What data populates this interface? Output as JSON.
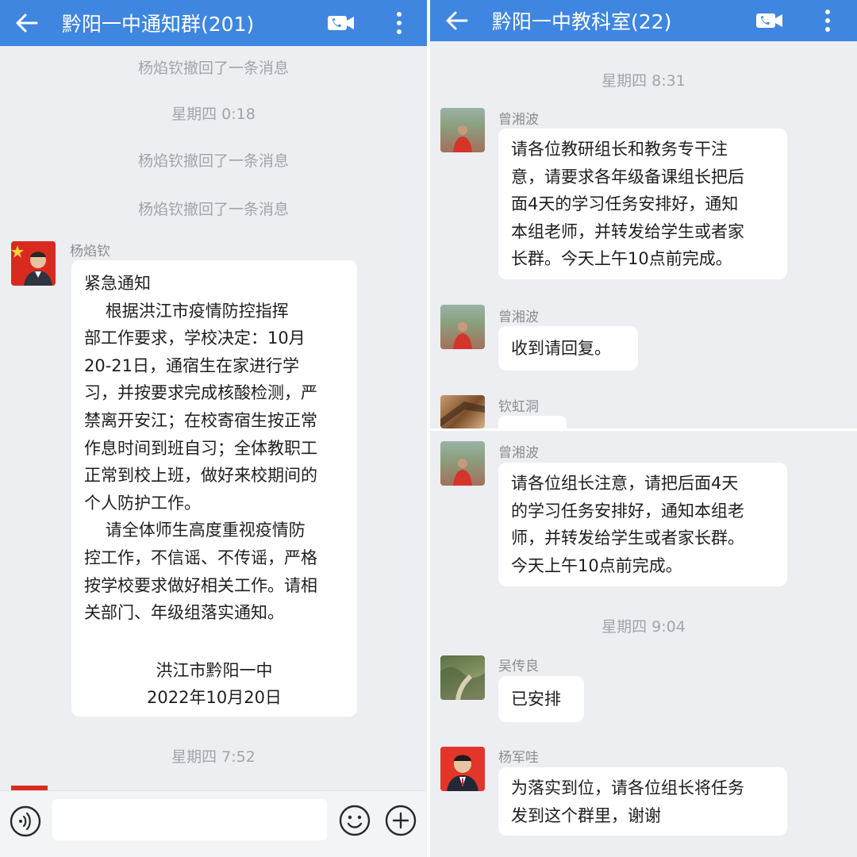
{
  "left": {
    "header": {
      "title": "黔阳一中通知群(201)"
    },
    "system_messages": [
      "杨焰钦撤回了一条消息",
      "星期四  0:18",
      "杨焰钦撤回了一条消息",
      "杨焰钦撤回了一条消息",
      "星期四  7:52"
    ],
    "message": {
      "sender": "杨焰钦",
      "lines": [
        "紧急通知",
        "    根据洪江市疫情防控指挥",
        "部工作要求，学校决定：10月",
        "20-21日，通宿生在家进行学",
        "习，并按要求完成核酸检测，严",
        "禁离开安江；在校寄宿生按正常",
        "作息时间到班自习；全体教职工",
        "正常到校上班，做好来校期间的",
        "个人防护工作。",
        "    请全体师生高度重视疫情防",
        "控工作，不信谣、不传谣，严格",
        "按学校要求做好相关工作。请相",
        "关部门、年级组落实通知。"
      ],
      "signature": [
        "洪江市黔阳一中",
        "2022年10月20日"
      ]
    }
  },
  "right": {
    "header": {
      "title": "黔阳一中教科室(22)"
    },
    "timestamps": [
      "星期四  8:31",
      "星期四  9:04"
    ],
    "messages": [
      {
        "sender": "曾湘波",
        "lines": [
          "请各位教研组长和教务专干注",
          "意，请要求各年级备课组长把后",
          "面4天的学习任务安排好，通知",
          "本组老师，并转发给学生或者家",
          "长群。今天上午10点前完成。"
        ]
      },
      {
        "sender": "曾湘波",
        "lines": [
          "收到请回复。"
        ]
      },
      {
        "sender": "钦虹洞",
        "lines": []
      },
      {
        "sender": "曾湘波",
        "lines": [
          "请各位组长注意，请把后面4天",
          "的学习任务安排好，通知本组老",
          "师，并转发给学生或者家长群。",
          "今天上午10点前完成。"
        ]
      },
      {
        "sender": "吴传良",
        "lines": [
          "已安排"
        ]
      },
      {
        "sender": "杨军哇",
        "lines": [
          "为落实到位，请各位组长将任务",
          "发到这个群里，谢谢"
        ]
      }
    ]
  },
  "icons": {
    "back": "arrow-left-icon",
    "video": "video-call-icon",
    "more": "more-vertical-icon",
    "voice": "voice-input-icon",
    "emoji": "emoji-icon",
    "plus": "plus-icon"
  },
  "colors": {
    "header": "#3f86e0",
    "background": "#eceef2",
    "bubble": "#ffffff",
    "flag_red": "#d92a1f"
  }
}
